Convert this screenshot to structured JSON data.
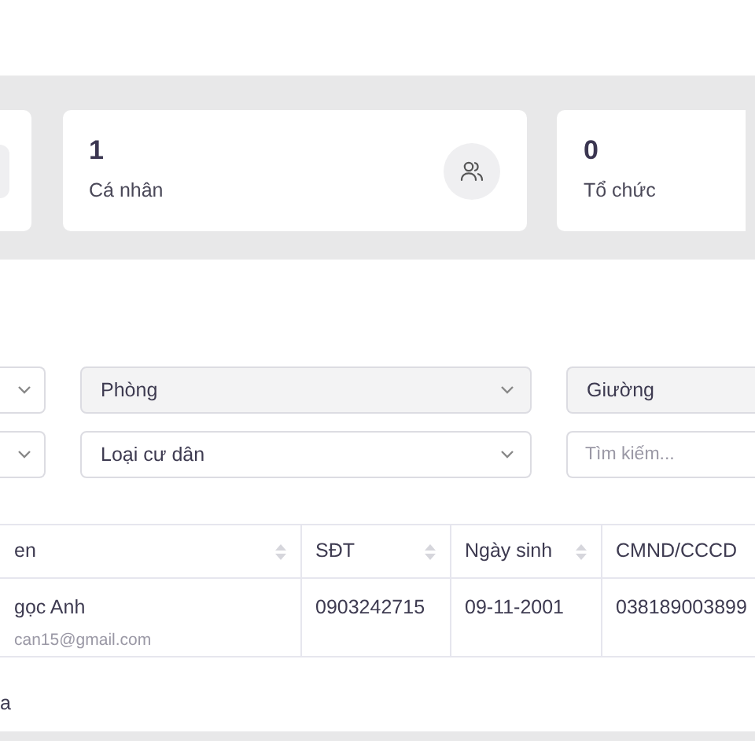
{
  "stat_cards": [
    {
      "value": "1",
      "label": "Cá nhân",
      "icon": true
    },
    {
      "value": "0",
      "label": "Tổ chức",
      "icon": false
    }
  ],
  "filter_rows": [
    [
      {
        "kind": "select",
        "disabled": false
      },
      {
        "kind": "select",
        "label": "Phòng",
        "disabled": true
      },
      {
        "kind": "select",
        "label": "Giường",
        "disabled": true
      }
    ],
    [
      {
        "kind": "select",
        "disabled": false
      },
      {
        "kind": "select",
        "label": "Loại cư dân",
        "disabled": false
      },
      {
        "kind": "search",
        "placeholder": "Tìm kiếm..."
      }
    ]
  ],
  "table": {
    "columns": [
      {
        "label": "en",
        "sortable": true
      },
      {
        "label": "SĐT",
        "sortable": true
      },
      {
        "label": "Ngày sinh",
        "sortable": true
      },
      {
        "label": "CMND/CCCD",
        "sortable": false
      }
    ],
    "rows": [
      {
        "name": "gọc Anh",
        "email": "can15@gmail.com",
        "phone": "0903242715",
        "dob": "09-11-2001",
        "id_number": "038189003899"
      }
    ]
  },
  "footer_text": "a"
}
